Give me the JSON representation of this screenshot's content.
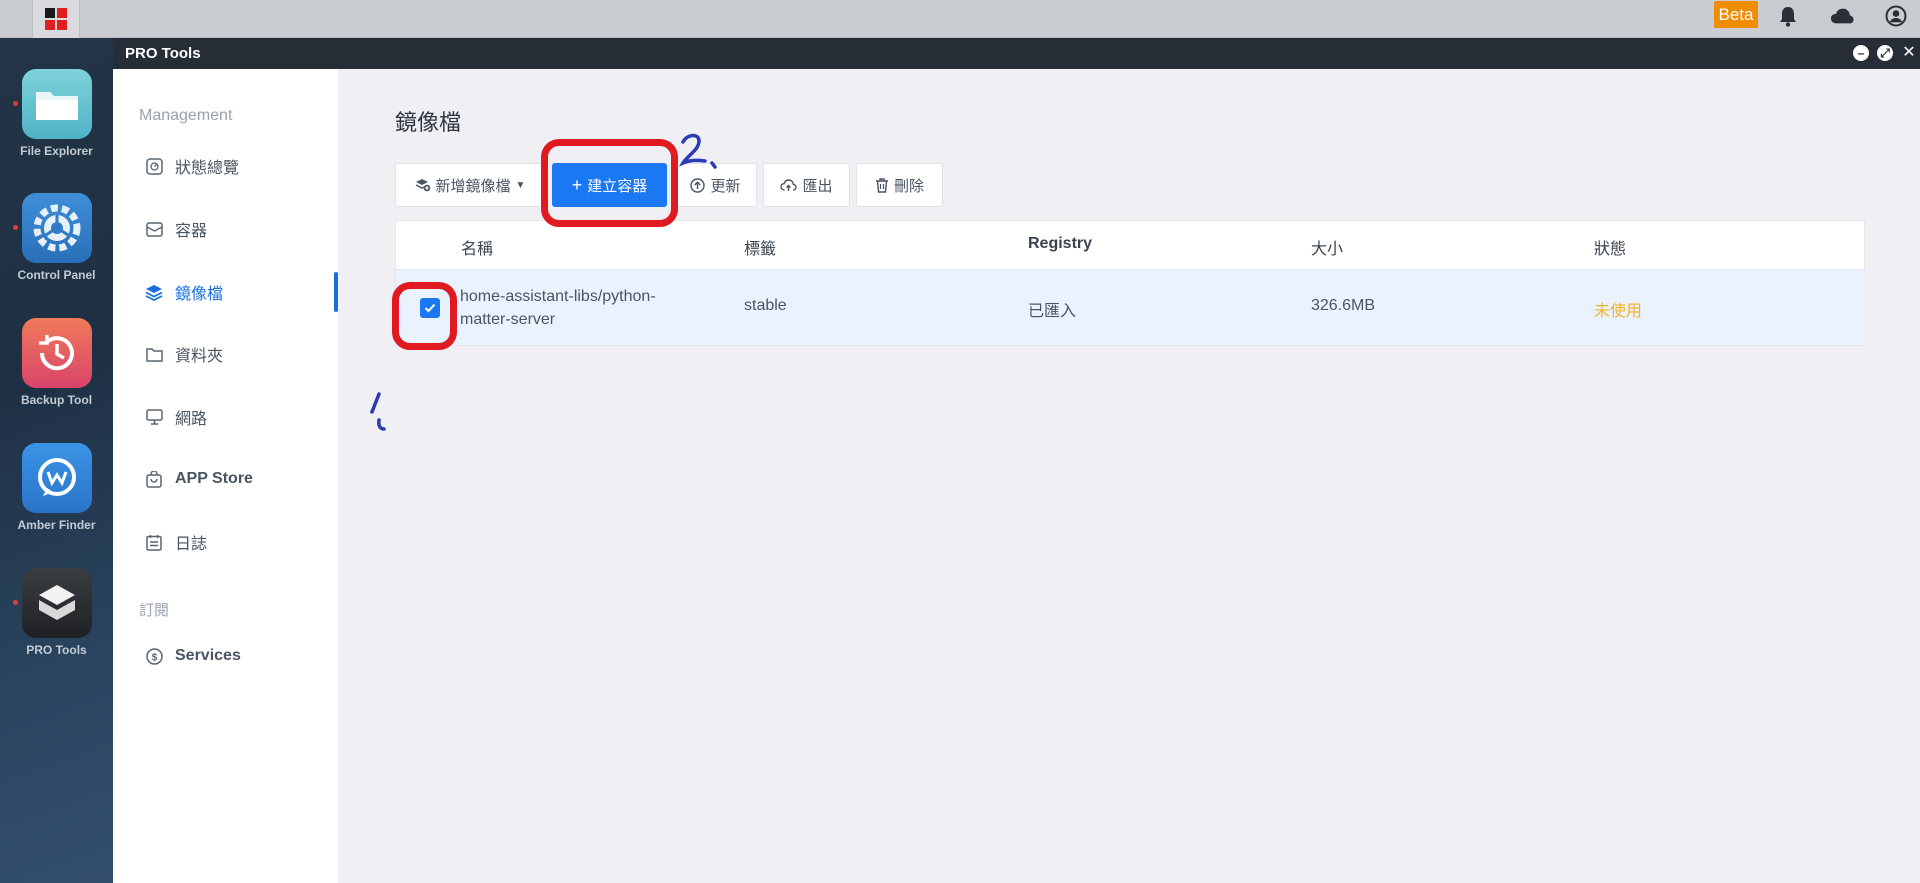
{
  "topbar": {
    "beta_label": "Beta"
  },
  "dock": {
    "items": [
      {
        "label": "File Explorer"
      },
      {
        "label": "Control Panel"
      },
      {
        "label": "Backup Tool"
      },
      {
        "label": "Amber Finder"
      },
      {
        "label": "PRO Tools"
      }
    ]
  },
  "window": {
    "title": "PRO Tools"
  },
  "sidebar": {
    "section_management": "Management",
    "items": [
      {
        "label": "狀態總覽"
      },
      {
        "label": "容器"
      },
      {
        "label": "鏡像檔"
      },
      {
        "label": "資料夾"
      },
      {
        "label": "網路"
      },
      {
        "label": "APP Store"
      },
      {
        "label": "日誌"
      }
    ],
    "section_subscribe": "訂閱",
    "services_label": "Services"
  },
  "main": {
    "title": "鏡像檔",
    "toolbar": {
      "add_image": "新增鏡像檔",
      "create_container": "建立容器",
      "update": "更新",
      "export": "匯出",
      "delete": "刪除"
    },
    "table": {
      "headers": [
        "名稱",
        "標籤",
        "Registry",
        "大小",
        "狀態"
      ],
      "rows": [
        {
          "name_line1": "home-assistant-libs/python-",
          "name_line2": "matter-server",
          "tag": "stable",
          "registry": "已匯入",
          "size": "326.6MB",
          "status": "未使用",
          "selected": true
        }
      ]
    }
  },
  "colors": {
    "accent": "#1a78f2",
    "status_unused": "#f0b429",
    "annotation_ring": "#e11a22",
    "annotation_ink": "#2b3bb5"
  },
  "icons": [
    "windows-logo-icon",
    "bell-icon",
    "cloud-icon",
    "user-icon",
    "minimize-icon",
    "restore-icon",
    "close-icon"
  ]
}
